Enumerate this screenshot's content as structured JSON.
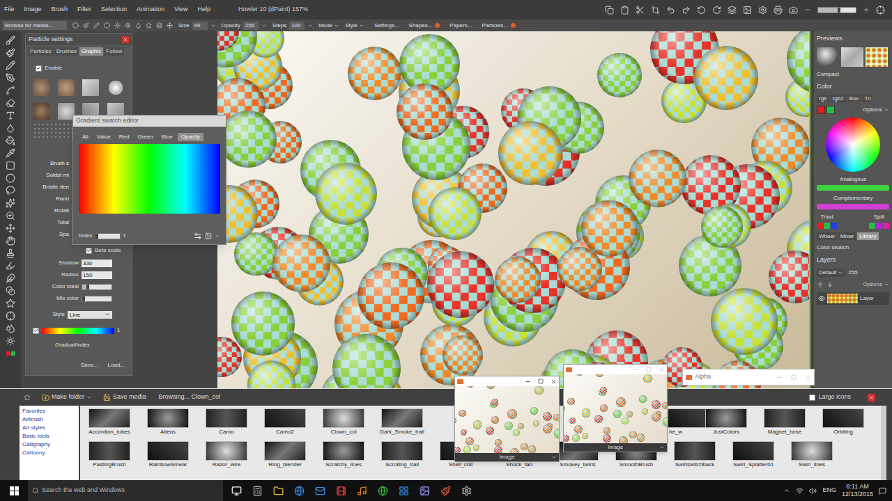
{
  "window": {
    "title": "Howler 10 (dPaint) 157%"
  },
  "menu": [
    "File",
    "Image",
    "Brush",
    "Filter",
    "Selection",
    "Animation",
    "View",
    "Help"
  ],
  "zoom": {
    "level": 0.55
  },
  "toolbar": {
    "browse": "Browse for media...",
    "fields": [
      {
        "label": "Size",
        "value": "99"
      },
      {
        "label": "Opacity",
        "value": "255"
      },
      {
        "label": "Steps",
        "value": "100"
      }
    ],
    "dropdowns": [
      "Mode",
      "Style"
    ],
    "buttons": [
      {
        "label": "Settings...",
        "dot": false
      },
      {
        "label": "Shapes...",
        "dot": true
      },
      {
        "label": "Papers...",
        "dot": false
      },
      {
        "label": "Particles...",
        "dot": true
      }
    ]
  },
  "tool_colors": {
    "primary": "#e02020",
    "secondary": "#20c040"
  },
  "particle_panel": {
    "title": "Particle settings",
    "tabs": [
      {
        "label": "Particles",
        "selected": false
      },
      {
        "label": "Brushes",
        "selected": false
      },
      {
        "label": "Graphic",
        "selected": true
      },
      {
        "label": "Follow",
        "selected": false
      }
    ],
    "enable": {
      "label": "Enable",
      "checked": true
    },
    "cut_labels": [
      "Brush s",
      "Soldst mi",
      "Bristle den",
      "Rand",
      "Rotati",
      "Total",
      "Spa"
    ],
    "beta_scale": {
      "label": "Beta scale",
      "checked": true
    },
    "fields": [
      {
        "label": "Shadow",
        "value": "330"
      },
      {
        "label": "Radius",
        "value": "150"
      }
    ],
    "sliders": [
      {
        "label": "Color steal",
        "level": 0.2
      },
      {
        "label": "Mix color",
        "level": 0.05
      }
    ],
    "style": {
      "label": "Style",
      "value": "Line"
    },
    "gradient": {
      "checked": true,
      "value": "1"
    },
    "gradual_label": "Gradual/index",
    "buttons": [
      "Save...",
      "Load..."
    ]
  },
  "gradient_editor": {
    "title": "Gradient swatch editor",
    "tabs": [
      {
        "label": "All",
        "selected": false
      },
      {
        "label": "Value",
        "selected": false
      },
      {
        "label": "Red",
        "selected": false
      },
      {
        "label": "Green",
        "selected": false
      },
      {
        "label": "Blue",
        "selected": false
      },
      {
        "label": "Opacity",
        "selected": true
      }
    ],
    "index": {
      "label": "Index",
      "value": "1",
      "level": 0.05
    }
  },
  "right_panel": {
    "previews_title": "Previews",
    "compact": "Compact",
    "color_title": "Color",
    "color_tabs": [
      {
        "label": "rgb",
        "selected": false
      },
      {
        "label": "rgb2",
        "selected": false
      },
      {
        "label": "Box",
        "selected": false
      },
      {
        "label": "Tri",
        "selected": false
      }
    ],
    "swatches": [
      {
        "color": "#e02020"
      },
      {
        "color": "#20c040"
      }
    ],
    "options": "Options",
    "harmonies": [
      {
        "label": "Analogous",
        "color": "#3fd43f"
      },
      {
        "label": "Complementary",
        "color": "#d43fd4"
      }
    ],
    "triad": {
      "label": "Triad",
      "colors": [
        "#e02020",
        "#20c040",
        "#2040e0"
      ]
    },
    "split": {
      "label": "Split",
      "colors": [
        "#20c040",
        "#c020e0",
        "#e020a0"
      ]
    },
    "mode_tabs": [
      {
        "label": "Wheel",
        "selected": false
      },
      {
        "label": "Mixer",
        "selected": false
      },
      {
        "label": "Library",
        "selected": true
      }
    ],
    "color_swatch": "Color swatch",
    "layers_title": "Layers",
    "layer_mode": "Default",
    "layer_opacity": "255",
    "layer_options": "Options",
    "layers": [
      {
        "name": "Layer",
        "visible": true
      }
    ]
  },
  "media_browser": {
    "make_folder": "Make folder",
    "save_media": "Save media",
    "browsing": "Browsing... Clown_col",
    "large_icons": {
      "label": "Large icons",
      "checked": false
    },
    "categories": [
      "Favorites",
      "Airbrush",
      "Art styles",
      "Basic tools",
      "Calligraphy",
      "Cartoony"
    ],
    "row1_left": [
      "Accordion_tubes",
      "Aliens",
      "Camo",
      "Camo2",
      "Clown_col",
      "Dark_Smoke_trail"
    ],
    "row1_right_partial": "he_w",
    "row1_right": [
      "JustColors",
      "Magnet_hose",
      "Orbiting"
    ],
    "row2": [
      "PastingBrush",
      "RainbowSmear",
      "Razor_wire",
      "Ring_blender",
      "Scratchy_lines",
      "Scrolling_trail",
      "Shell_coil",
      "Shock_tan",
      "Smokey_twirls",
      "SmoothBrush",
      "Swirlswitchback",
      "Swirl_Splatter01",
      "Swirl_lines"
    ]
  },
  "image_windows": [
    {
      "footer": "Image",
      "active": true
    },
    {
      "footer": "Image",
      "active": false
    }
  ],
  "alpha_window": {
    "title": "Alpha"
  },
  "taskbar": {
    "search": "Search the web and Windows",
    "language": "ENG",
    "time": "6:11 AM",
    "date": "12/13/2015"
  }
}
